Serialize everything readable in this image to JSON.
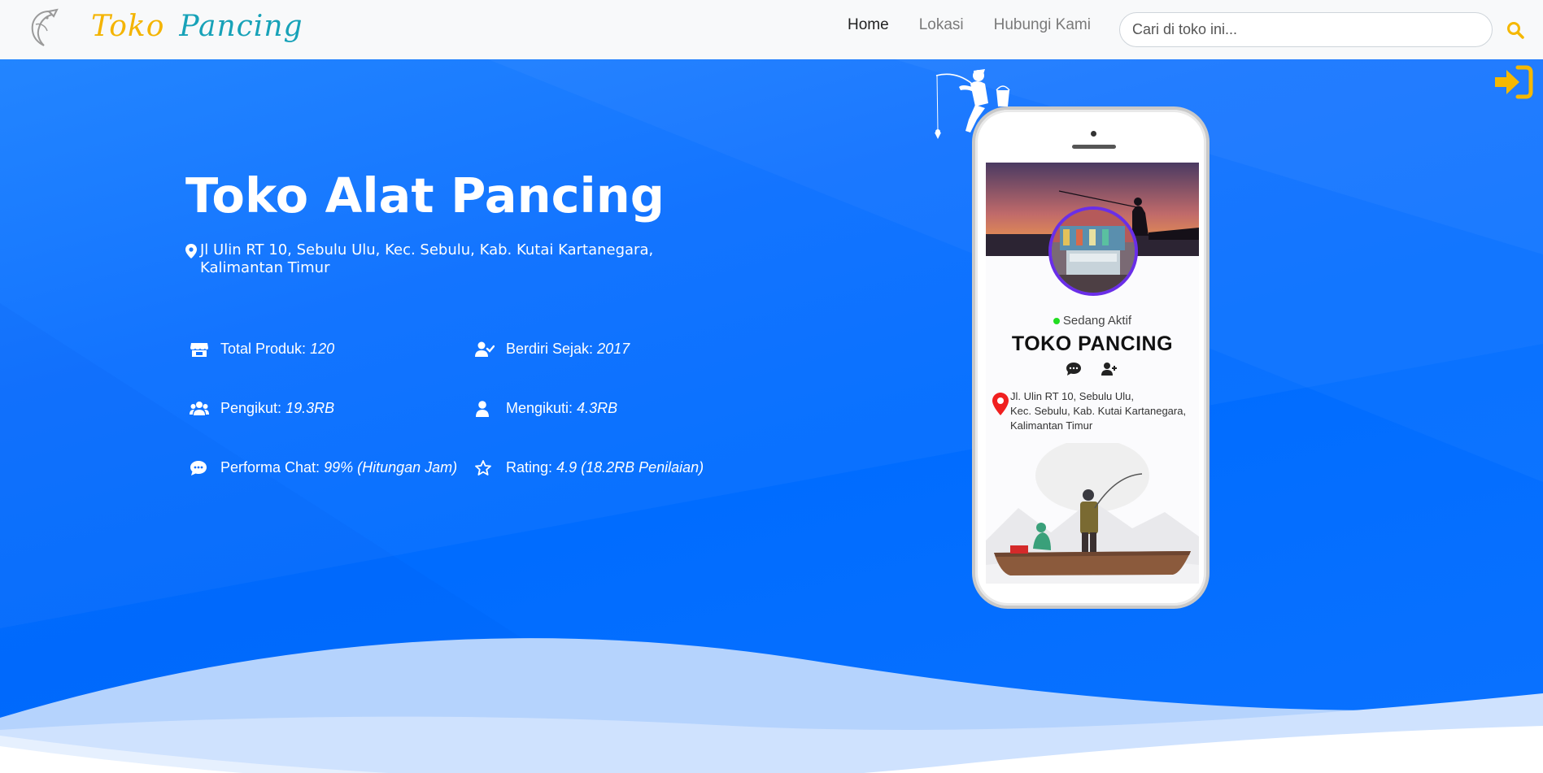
{
  "navbar": {
    "brand_word1": "Toko",
    "brand_word2": "Pancing",
    "links": [
      {
        "label": "Home",
        "active": true
      },
      {
        "label": "Lokasi",
        "active": false
      },
      {
        "label": "Hubungi Kami",
        "active": false
      }
    ],
    "search_placeholder": "Cari di toko ini...",
    "icons": {
      "logo": "fish-logo-icon",
      "search": "search-icon",
      "login": "sign-in-icon"
    }
  },
  "hero": {
    "title": "Toko Alat Pancing",
    "address_line1": "Jl Ulin RT 10, Sebulu Ulu, Kec. Sebulu, Kab. Kutai Kartanegara,",
    "address_line2": "Kalimantan Timur",
    "stats": [
      {
        "icon": "store-icon",
        "label": "Total Produk:",
        "value": "120"
      },
      {
        "icon": "user-check-icon",
        "label": "Berdiri Sejak:",
        "value": "2017"
      },
      {
        "icon": "users-icon",
        "label": "Pengikut:",
        "value": "19.3RB"
      },
      {
        "icon": "user-icon",
        "label": "Mengikuti:",
        "value": "4.3RB"
      },
      {
        "icon": "comment-dots-icon",
        "label": "Performa Chat:",
        "value": "99% (Hitungan Jam)"
      },
      {
        "icon": "star-icon",
        "label": "Rating:",
        "value": "4.9 (18.2RB Penilaian)"
      }
    ]
  },
  "phone": {
    "status": "Sedang Aktif",
    "shop_name": "TOKO PANCING",
    "address_lines": [
      "Jl. Ulin RT 10, Sebulu Ulu,",
      "Kec. Sebulu, Kab. Kutai Kartanegara,",
      "Kalimantan Timur"
    ]
  },
  "colors": {
    "hero_blue": "#006cff",
    "brand_yellow": "#f4b400",
    "brand_teal": "#17a2b8",
    "login_yellow": "#f5b800",
    "avatar_border": "#6a2ee8",
    "status_green": "#22dd22"
  }
}
